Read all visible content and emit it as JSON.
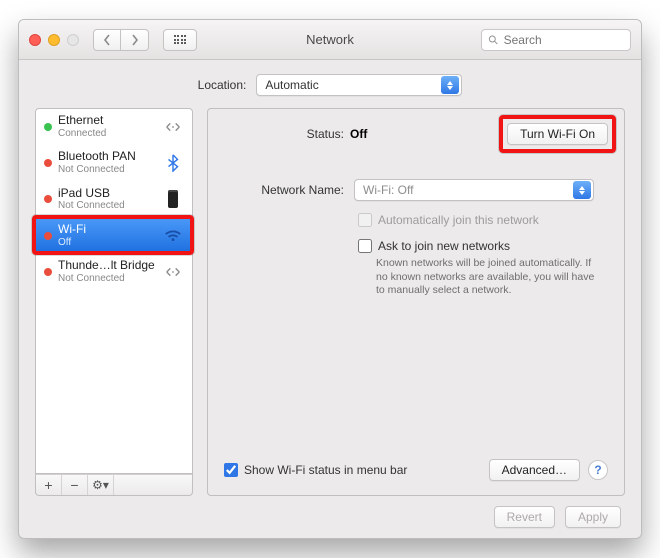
{
  "window": {
    "title": "Network"
  },
  "toolbar": {
    "back_icon": "chevron-left",
    "forward_icon": "chevron-right",
    "search_placeholder": "Search"
  },
  "location": {
    "label": "Location:",
    "value": "Automatic"
  },
  "sidebar": {
    "items": [
      {
        "name": "Ethernet",
        "sub": "Connected",
        "status": "green",
        "icon": "sync"
      },
      {
        "name": "Bluetooth PAN",
        "sub": "Not Connected",
        "status": "red",
        "icon": "bluetooth"
      },
      {
        "name": "iPad USB",
        "sub": "Not Connected",
        "status": "red",
        "icon": "phone"
      },
      {
        "name": "Wi-Fi",
        "sub": "Off",
        "status": "red",
        "icon": "wifi",
        "selected": true
      },
      {
        "name": "Thunde…lt Bridge",
        "sub": "Not Connected",
        "status": "red",
        "icon": "sync"
      }
    ],
    "footer": {
      "add": "+",
      "remove": "−",
      "actions": "⚙︎▾"
    }
  },
  "detail": {
    "status_label": "Status:",
    "status_value": "Off",
    "toggle_button": "Turn Wi-Fi On",
    "network_name_label": "Network Name:",
    "network_name_value": "Wi-Fi: Off",
    "auto_join_label": "Automatically join this network",
    "ask_label": "Ask to join new networks",
    "ask_hint": "Known networks will be joined automatically. If no known networks are available, you will have to manually select a network.",
    "show_status_label": "Show Wi-Fi status in menu bar",
    "advanced_label": "Advanced…"
  },
  "footer": {
    "revert": "Revert",
    "apply": "Apply"
  },
  "colors": {
    "highlight": "#f11414",
    "select_blue": "#2f77e6"
  }
}
